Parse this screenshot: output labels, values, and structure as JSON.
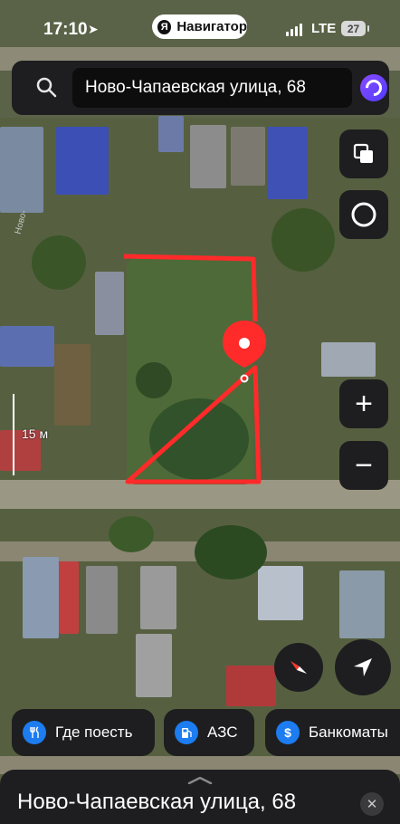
{
  "status_bar": {
    "time": "17:10",
    "app_name": "Навигатор",
    "app_badge": "Я",
    "network": "LTE",
    "battery": "27"
  },
  "search": {
    "query": "Ново-Чапаевская улица, 68"
  },
  "map": {
    "scale_label": "15 м",
    "street_label": "Ново-",
    "zoom_in": "+",
    "zoom_out": "−",
    "outline_color": "#ff2a2a",
    "pin_color": "#ff2a2a"
  },
  "categories": [
    {
      "label": "Где поесть",
      "icon": "fork-knife-icon"
    },
    {
      "label": "АЗС",
      "icon": "fuel-pump-icon"
    },
    {
      "label": "Банкоматы",
      "icon": "dollar-icon"
    }
  ],
  "sheet": {
    "title": "Ново-Чапаевская улица, 68",
    "close": "✕"
  }
}
